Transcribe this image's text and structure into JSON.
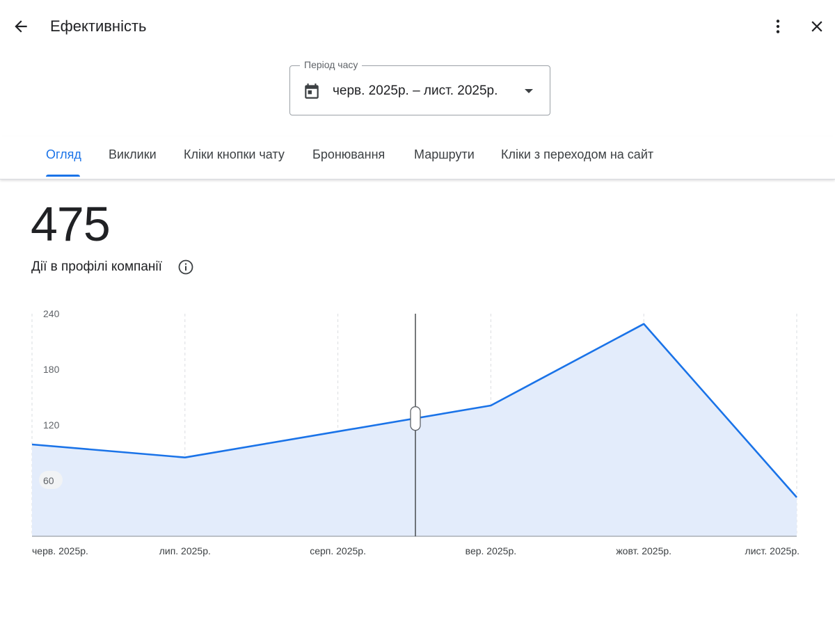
{
  "header": {
    "title": "Ефективність",
    "back_icon": "arrow-back-icon",
    "more_icon": "more-vert-icon",
    "close_icon": "close-icon"
  },
  "period": {
    "label": "Період часу",
    "value": "черв. 2025р. – лист. 2025р.",
    "icon": "calendar-icon"
  },
  "tabs": [
    {
      "label": "Огляд",
      "active": true
    },
    {
      "label": "Виклики",
      "active": false
    },
    {
      "label": "Кліки кнопки чату",
      "active": false
    },
    {
      "label": "Бронювання",
      "active": false
    },
    {
      "label": "Маршрути",
      "active": false
    },
    {
      "label": "Кліки з переходом на сайт",
      "active": false
    }
  ],
  "summary": {
    "total": "475",
    "label": "Дії в профілі компанії",
    "info_icon": "info-icon"
  },
  "colors": {
    "accent": "#1a73e8",
    "area_fill": "#e3ecfb"
  },
  "chart_data": {
    "type": "area",
    "x": [
      "черв. 2025р.",
      "лип. 2025р.",
      "серп. 2025р.",
      "вер. 2025р.",
      "жовт. 2025р.",
      "лист. 2025р."
    ],
    "values": [
      99,
      85,
      null,
      141,
      229,
      42
    ],
    "cursor_value": 127,
    "y_ticks": [
      240,
      180,
      120,
      60
    ],
    "ylim": [
      0,
      240
    ],
    "grid": "vertical-dashed"
  }
}
